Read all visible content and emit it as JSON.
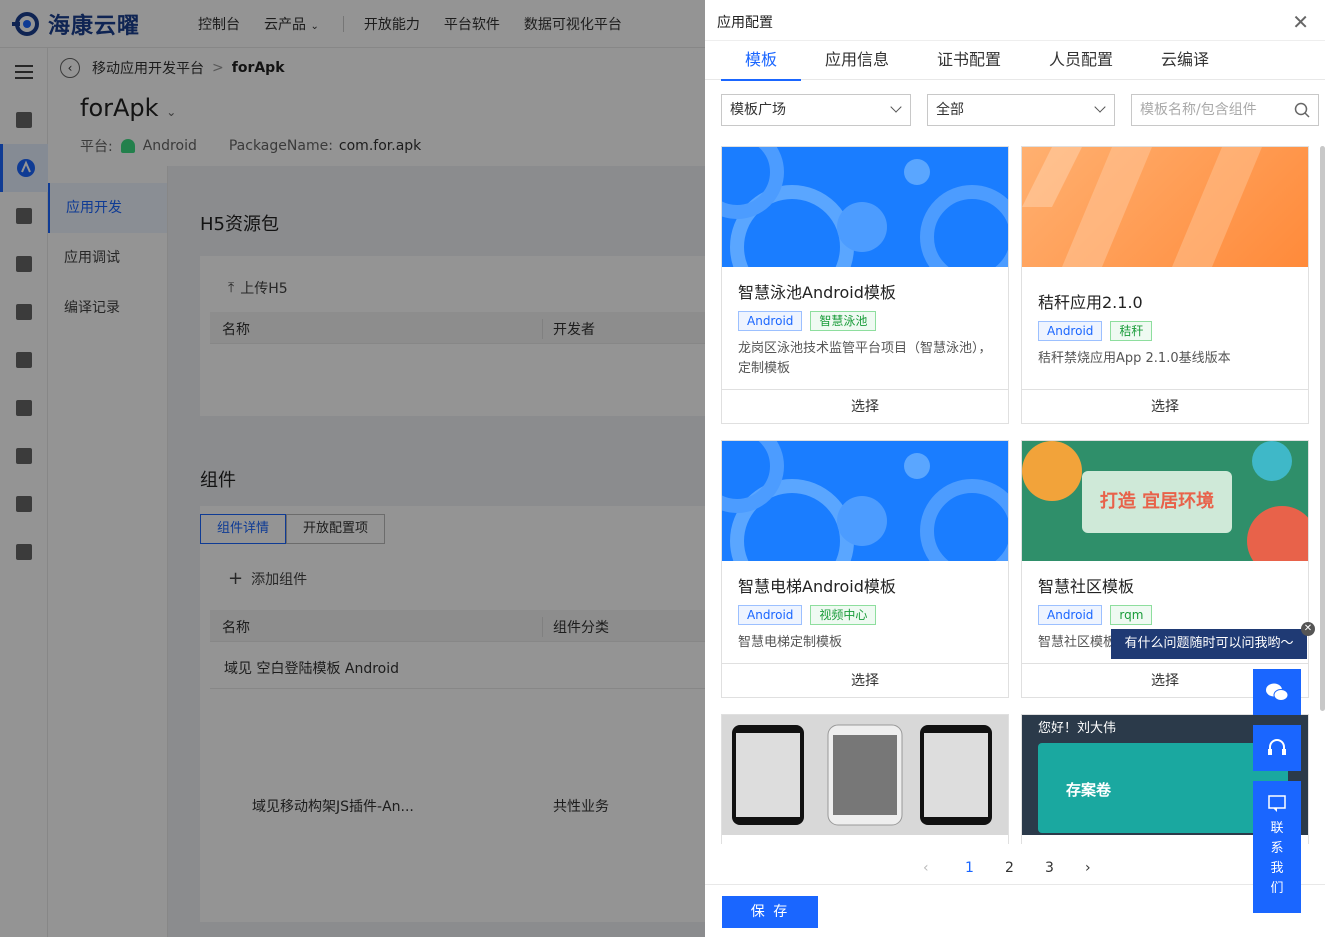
{
  "brand": {
    "name": "海康云曜"
  },
  "topnav": [
    "控制台",
    "云产品",
    "开放能力",
    "平台软件",
    "数据可视化平台"
  ],
  "breadcrumb": {
    "parent": "移动应用开发平台",
    "current": "forApk"
  },
  "app": {
    "title": "forApk",
    "platform_label": "平台:",
    "platform": "Android",
    "package_label": "PackageName:",
    "package": "com.for.apk"
  },
  "left_menu": [
    "应用开发",
    "应用调试",
    "编译记录"
  ],
  "main": {
    "h5_title": "H5资源包",
    "upload_label": "上传H5",
    "h5_table_cols": [
      "名称",
      "开发者"
    ],
    "comp_title": "组件",
    "comp_tabs": [
      "组件详情",
      "开放配置项"
    ],
    "add_label": "添加组件",
    "comp_table_cols": [
      "名称",
      "组件分类"
    ],
    "comp_rows": [
      {
        "name": "域见 空白登陆模板 Android",
        "category": ""
      },
      {
        "name": "域见移动构架JS插件-An...",
        "category": "共性业务"
      }
    ]
  },
  "drawer": {
    "title": "应用配置",
    "tabs": [
      "模板",
      "应用信息",
      "证书配置",
      "人员配置",
      "云编译"
    ],
    "filter1": "模板广场",
    "filter2": "全部",
    "search_placeholder": "模板名称/包含组件",
    "choose_label": "选择",
    "templates": [
      {
        "name": "智慧泳池Android模板",
        "tags": [
          "Android",
          "智慧泳池"
        ],
        "desc": "龙岗区泳池技术监管平台项目（智慧泳池），定制模板"
      },
      {
        "name": "秸秆应用2.1.0",
        "tags": [
          "Android",
          "秸秆"
        ],
        "desc": "秸秆禁烧应用App 2.1.0基线版本"
      },
      {
        "name": "智慧电梯Android模板",
        "tags": [
          "Android",
          "视频中心"
        ],
        "desc": "智慧电梯定制模板"
      },
      {
        "name": "智慧社区模板",
        "tags": [
          "Android",
          "rqm"
        ],
        "desc": "智慧社区模板",
        "banner": "打造 宜居环境"
      }
    ],
    "card6_greeting": "您好！刘大伟",
    "card6_label": "存案卷",
    "pages": [
      "1",
      "2",
      "3"
    ],
    "current_page": "1",
    "save_label": "保 存"
  },
  "float": {
    "tooltip": "有什么问题随时可以问我哟～",
    "contact": "联系我们"
  },
  "colors": {
    "primary": "#1a66ff",
    "brand": "#1a3f8f",
    "tag_green": "#1a9c3a"
  }
}
